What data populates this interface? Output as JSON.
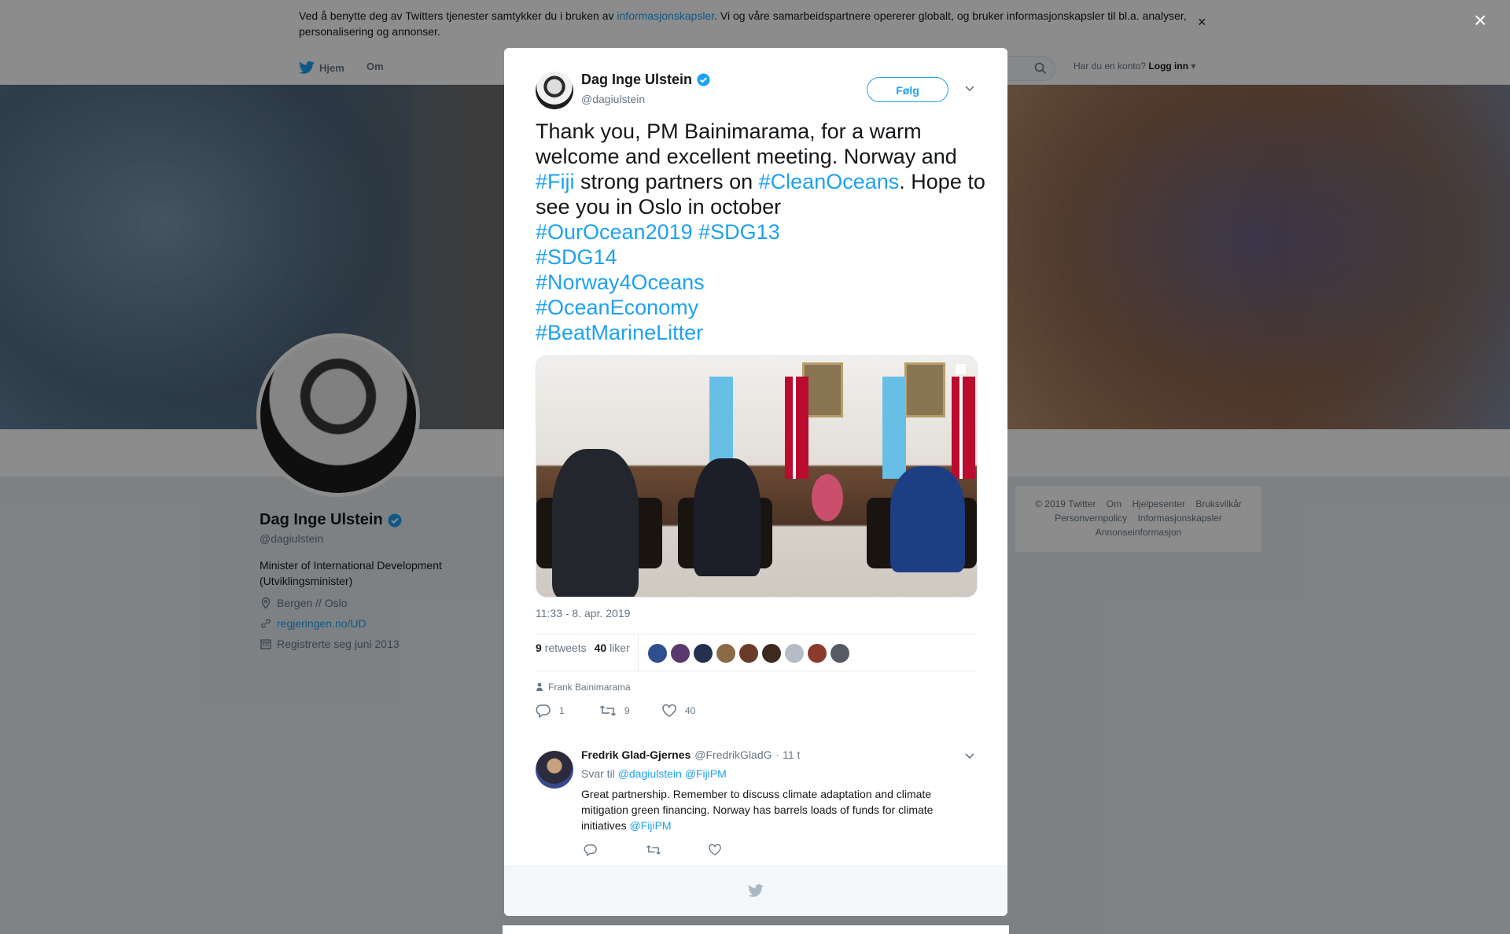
{
  "cookie": {
    "text_before": "Ved å benytte deg av Twitters tjenester samtykker du i bruken av ",
    "link": "informasjonskapsler",
    "text_after": ". Vi og våre samarbeidspartnere opererer globalt, og bruker informasjonskapsler til bl.a. analyser, personalisering og annonser.",
    "close": "×"
  },
  "nav": {
    "home": "Hjem",
    "about": "Om",
    "login_prompt": "Har du en konto?",
    "login": "Logg inn"
  },
  "profile": {
    "name": "Dag Inge Ulstein",
    "handle": "@dagiulstein",
    "bio": "Minister of International Development (Utviklingsminister)",
    "location": "Bergen // Oslo",
    "website": "regjeringen.no/UD",
    "joined": "Registrerte seg juni 2013"
  },
  "footer": {
    "copyright": "© 2019 Twitter",
    "about": "Om",
    "help": "Hjelpesenter",
    "terms": "Bruksvilkår",
    "privacy": "Personvernpolicy",
    "cookies": "Informasjonskapsler",
    "ads": "Annonseinformasjon"
  },
  "modal_close": "×",
  "tweet": {
    "author_name": "Dag Inge Ulstein",
    "author_handle": "@dagiulstein",
    "follow": "Følg",
    "text_1": "Thank you, PM Bainimarama, for a warm welcome and excellent meeting. Norway and ",
    "tag_fiji": "#Fiji",
    "text_2": " strong partners on ",
    "tag_cleanoceans": "#CleanOceans",
    "text_3": ". Hope to see you in Oslo in october",
    "tag_ourocean": "#OurOcean2019",
    "tag_sdg13": "#SDG13",
    "tag_sdg14": "#SDG14",
    "tag_norway4oceans": "#Norway4Oceans",
    "tag_oceaneconomy": "#OceanEconomy",
    "tag_beatmarinelitter": "#BeatMarineLitter",
    "timestamp": "11:33 - 8. apr. 2019",
    "retweets_count": "9",
    "retweets_label": "retweets",
    "likes_count": "40",
    "likes_label": "liker",
    "tagged_person": "Frank Bainimarama",
    "reply_count": "1",
    "retweet_count": "9",
    "like_count": "40"
  },
  "likers_colors": [
    "#2f4f8f",
    "#5a3a6e",
    "#23304f",
    "#8c6a45",
    "#6b3b2a",
    "#3c2a1e",
    "#b4bcc6",
    "#8a3b2e",
    "#555b60"
  ],
  "reply": {
    "name": "Fredrik Glad-Gjernes",
    "handle": "@FredrikGladG",
    "time": "· 11 t",
    "reply_to_label": "Svar til",
    "reply_to_1": "@dagiulstein",
    "reply_to_2": "@FijiPM",
    "text": "Great partnership. Remember to discuss climate adaptation and climate mitigation green financing. Norway has barrels loads of funds for climate initiatives ",
    "mention": "@FijiPM"
  },
  "colors": {
    "accent": "#1da1f2",
    "muted": "#657786",
    "text": "#14171a"
  }
}
